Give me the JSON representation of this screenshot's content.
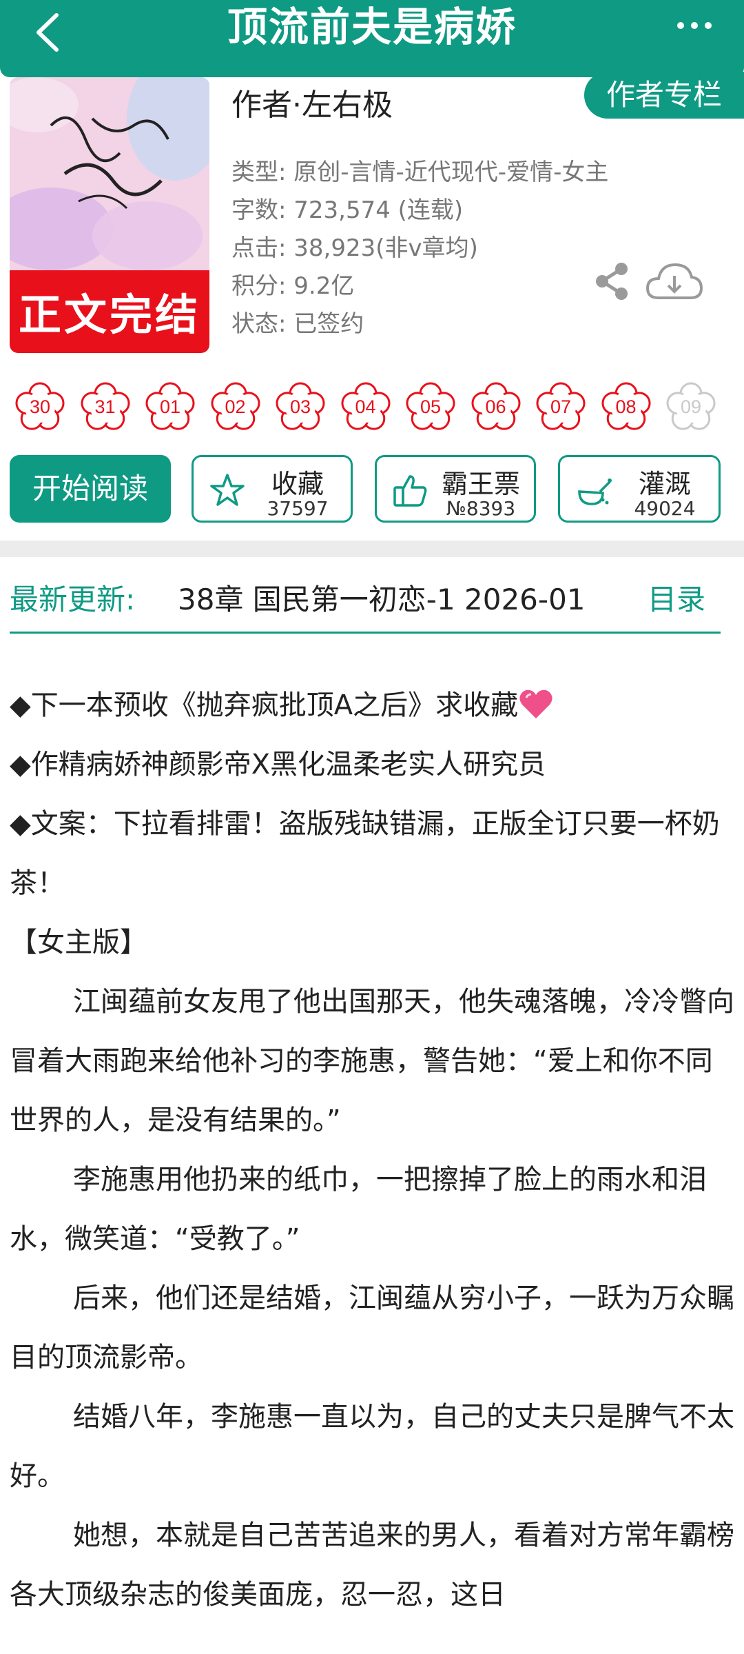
{
  "header": {
    "title": "顶流前夫是病娇"
  },
  "book": {
    "cover_banner": "正文完结",
    "author": "作者·左右极",
    "author_column_label": "作者专栏",
    "meta": {
      "type": "类型: 原创-言情-近代现代-爱情-女主",
      "word_count": "字数: 723,574 (连载)",
      "clicks": "点击: 38,923(非v章均)",
      "points": "积分: 9.2亿",
      "status": "状态: 已签约"
    }
  },
  "calendar": {
    "days": [
      {
        "label": "30",
        "active": true
      },
      {
        "label": "31",
        "active": true
      },
      {
        "label": "01",
        "active": true
      },
      {
        "label": "02",
        "active": true
      },
      {
        "label": "03",
        "active": true
      },
      {
        "label": "04",
        "active": true
      },
      {
        "label": "05",
        "active": true
      },
      {
        "label": "06",
        "active": true
      },
      {
        "label": "07",
        "active": true
      },
      {
        "label": "08",
        "active": true
      },
      {
        "label": "09",
        "active": false
      }
    ],
    "active_color": "#e8101a",
    "inactive_color": "#c9c9c9"
  },
  "actions": {
    "read_label": "开始阅读",
    "favorite": {
      "label": "收藏",
      "count": "37597",
      "icon": "star-icon"
    },
    "bawang": {
      "label": "霸王票",
      "count": "№8393",
      "icon": "thumbs-up-icon"
    },
    "irrigate": {
      "label": "灌溉",
      "count": "49024",
      "icon": "watering-can-icon"
    }
  },
  "latest": {
    "label": "最新更新:",
    "text": "38章  国民第一初恋-1  2026-01",
    "catalog_label": "目录"
  },
  "intro": {
    "line1": "◆下一本预收《抛弃疯批顶A之后》求收藏",
    "line2": "◆作精病娇神颜影帝X黑化温柔老实人研究员",
    "line3": "◆文案：下拉看排雷！盗版残缺错漏，正版全订只要一杯奶茶！",
    "line4": "【女主版】",
    "p1": "江闽蕴前女友甩了他出国那天，他失魂落魄，冷冷瞥向冒着大雨跑来给他补习的李施惠，警告她：“爱上和你不同世界的人，是没有结果的。”",
    "p2": "李施惠用他扔来的纸巾，一把擦掉了脸上的雨水和泪水，微笑道：“受教了。”",
    "p3": "后来，他们还是结婚，江闽蕴从穷小子，一跃为万众瞩目的顶流影帝。",
    "p4": "结婚八年，李施惠一直以为，自己的丈夫只是脾气不太好。",
    "p5": "她想，本就是自己苦苦追来的男人，看着对方常年霸榜各大顶级杂志的俊美面庞，忍一忍，这日"
  },
  "colors": {
    "brand": "#0f9a84",
    "banner_red": "#e8101a",
    "heart_pink": "#f0508a"
  }
}
